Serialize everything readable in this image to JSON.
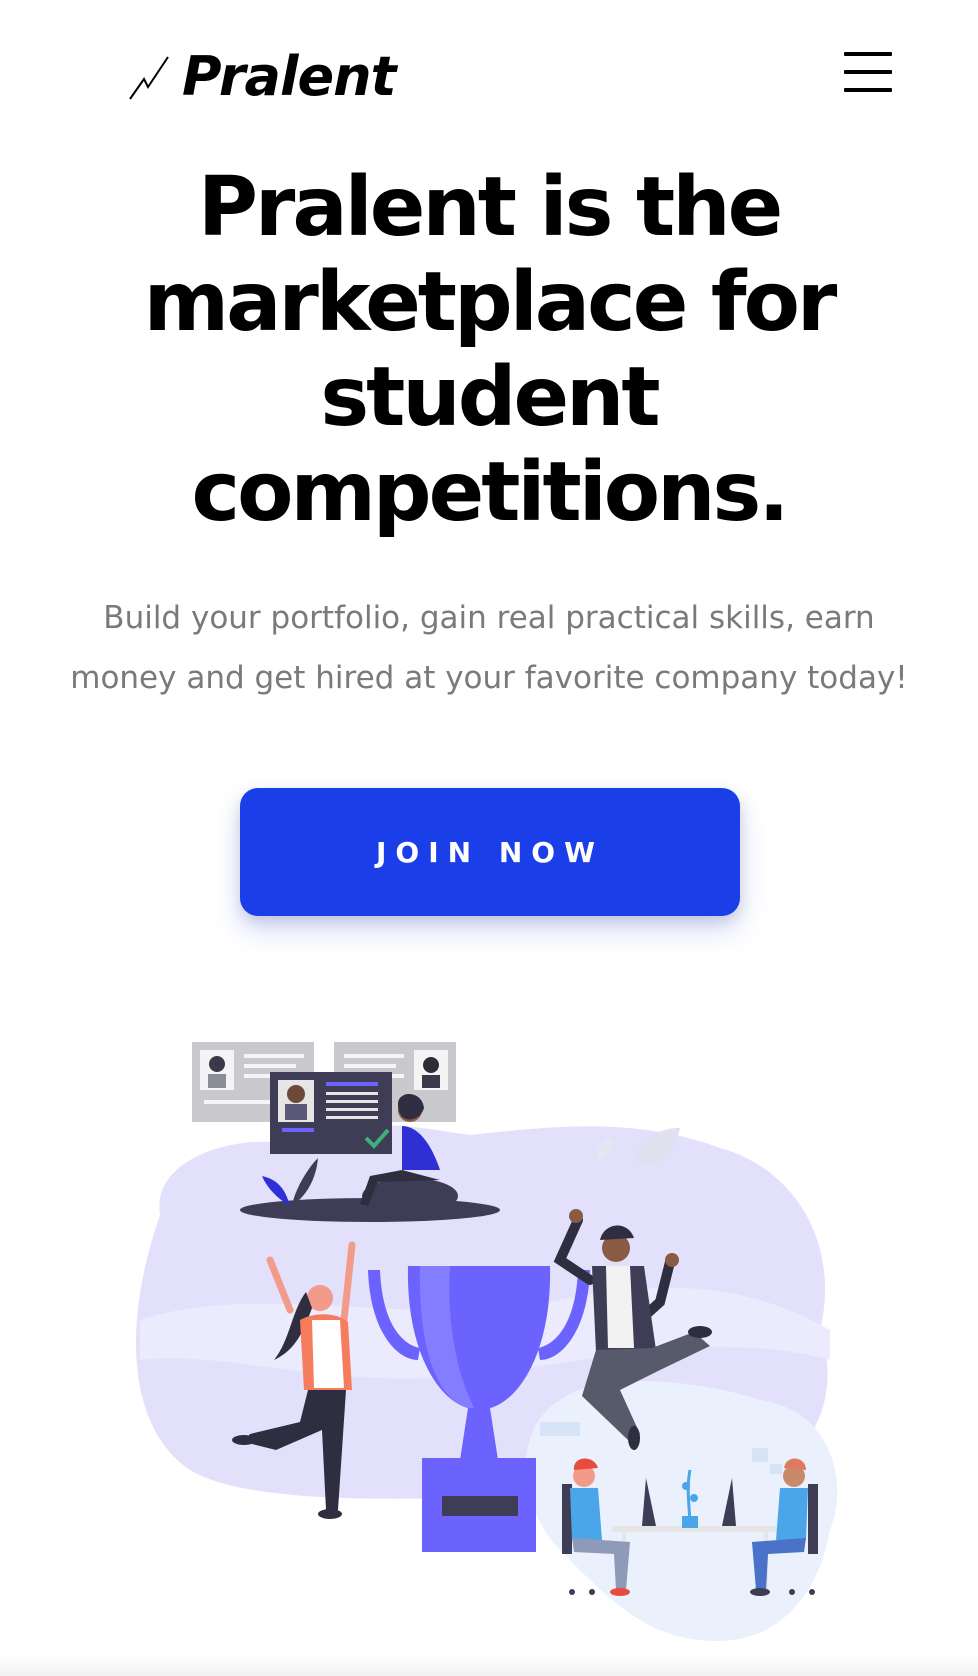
{
  "brand": {
    "name": "Pralent",
    "accent_color": "#1a3ee8",
    "logo_icon": "zigzag-logo-icon"
  },
  "header": {
    "menu_icon": "hamburger-menu-icon"
  },
  "hero": {
    "title_lines": [
      "Pralent is the",
      "marketplace for",
      "student",
      "competitions."
    ],
    "subtitle_lines": [
      "Build your portfolio, gain real practical skills, earn",
      "money and get hired at your favorite company today!"
    ],
    "cta_label": "JOIN NOW"
  },
  "illustration": {
    "icons": [
      "trophy-icon",
      "profile-card-icon",
      "celebrating-person-icon",
      "desk-workers-icon"
    ]
  }
}
